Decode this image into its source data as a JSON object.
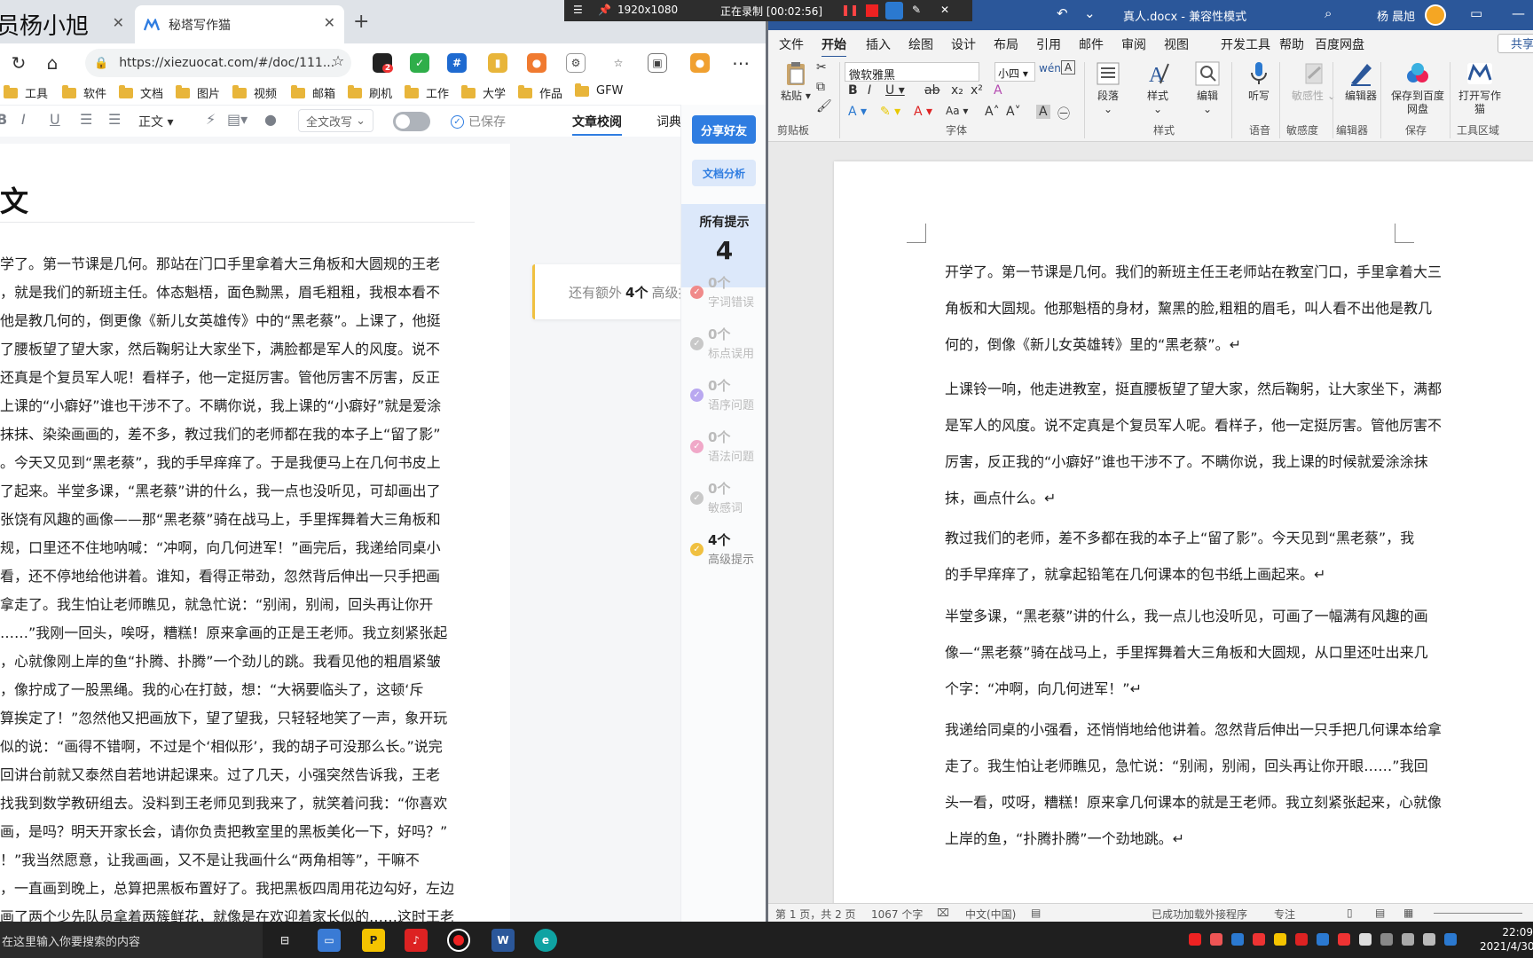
{
  "browser": {
    "tabs": [
      {
        "label": "员杨小旭"
      },
      {
        "label": "秘塔写作猫"
      }
    ],
    "url": "https://xiezuocat.com/#/doc/111...",
    "extension_badge": "2",
    "bookmarks": [
      "工具",
      "软件",
      "文档",
      "图片",
      "视频",
      "邮箱",
      "刷机",
      "工作",
      "大学",
      "作品",
      "GFW"
    ]
  },
  "editor": {
    "style_label": "正文",
    "rewrite_label": "全文改写",
    "saved_label": "已保存",
    "tabs": [
      "文章校阅",
      "词典"
    ],
    "title": "文",
    "lines": [
      "学了。第一节课是几何。那站在门口手里拿着大三角板和大圆规的王老",
      "，就是我们的新班主任。体态魁梧，面色黝黑，眉毛粗粗，我根本看不",
      "他是教几何的，倒更像《新儿女英雄传》中的“黑老蔡”。上课了，他挺",
      "了腰板望了望大家，然后鞠躬让大家坐下，满脸都是军人的风度。说不",
      "还真是个复员军人呢！看样子，他一定挺厉害。管他厉害不厉害，反正",
      "上课的“小癖好”谁也干涉不了。不瞒你说，我上课的“小癖好”就是爱涂",
      "抹抹、染染画画的，差不多，教过我们的老师都在我的本子上“留了影”",
      "。今天又见到“黑老蔡”，我的手早痒痒了。于是我便马上在几何书皮上",
      "了起来。半堂多课，“黑老蔡”讲的什么，我一点也没听见，可却画出了",
      "张饶有风趣的画像——那“黑老蔡”骑在战马上，手里挥舞着大三角板和",
      "规，口里还不住地呐喊：“冲啊，向几何进军！”画完后，我递给同桌小",
      "看，还不停地给他讲着。谁知，看得正带劲，忽然背后伸出一只手把画",
      "拿走了。我生怕让老师瞧见，就急忙说：“别闹，别闹，回头再让你开",
      "……”我刚一回头，唉呀，糟糕！原来拿画的正是王老师。我立刻紧张起",
      "，心就像刚上岸的鱼“扑腾、扑腾”一个劲儿的跳。我看见他的粗眉紧皱",
      "，像拧成了一股黑绳。我的心在打鼓，想：“大祸要临头了，这顿‘斥",
      "算挨定了！”忽然他又把画放下，望了望我，只轻轻地笑了一声，象开玩",
      "似的说：“画得不错啊，不过是个‘相似形’，我的胡子可没那么长。”说完",
      "回讲台前就又泰然自若地讲起课来。过了几天，小强突然告诉我，王老",
      "找我到数学教研组去。没料到王老师见到我来了，就笑着问我：“你喜欢",
      "画，是吗？明天开家长会，请你负责把教室里的黑板美化一下，好吗？”",
      "！”我当然愿意，让我画画，又不是让我画什么“两角相等”，干嘛不",
      "，一直画到晚上，总算把黑板布置好了。我把黑板四周用花边勾好，左边",
      "画了两个少先队员拿着两簇鲜花，就像是在欢迎着家长似的……这时王老"
    ],
    "notice": {
      "prefix": "还有额外",
      "count": "4个",
      "suffix": "高级提示"
    },
    "panel": {
      "share_label": "分享好友",
      "analyze_label": "文档分析",
      "all_hints_label": "所有提示",
      "all_hints_count": "4",
      "categories": [
        {
          "count": "0个",
          "label": "字词错误",
          "color": "#f08a8a"
        },
        {
          "count": "0个",
          "label": "标点误用",
          "color": "#c8c8c8"
        },
        {
          "count": "0个",
          "label": "语序问题",
          "color": "#b9a8f0"
        },
        {
          "count": "0个",
          "label": "语法问题",
          "color": "#f0a8c8"
        },
        {
          "count": "0个",
          "label": "敏感词",
          "color": "#c8c8c8"
        },
        {
          "count": "4个",
          "label": "高级提示",
          "color": "#f0c040"
        }
      ]
    }
  },
  "recorder": {
    "resolution": "1920x1080",
    "status": "正在录制 [00:02:56]"
  },
  "word": {
    "title": "真人.docx - 兼容性模式",
    "user": "杨 晨旭",
    "menu": [
      "文件",
      "开始",
      "插入",
      "绘图",
      "设计",
      "布局",
      "引用",
      "邮件",
      "审阅",
      "视图",
      "开发工具",
      "帮助",
      "百度网盘"
    ],
    "share_label": "共享",
    "font_name": "微软雅黑",
    "font_size": "小四",
    "ribbon_groups": [
      "剪贴板",
      "字体",
      "样式",
      "语音",
      "敏感度",
      "编辑器",
      "保存",
      "工具区域"
    ],
    "ribbon_buttons": [
      "粘贴",
      "段落",
      "样式",
      "编辑",
      "听写",
      "敏感性",
      "编辑器",
      "保存到百度网盘",
      "打开写作猫"
    ],
    "paragraphs": [
      [
        "开学了。第一节课是几何。我们的新班主任王老师站在教室门口，手里拿着大三",
        "角板和大圆规。他那魁梧的身材，黧黑的脸,粗粗的眉毛，叫人看不出他是教几",
        "何的，倒像《新儿女英雄转》里的“黑老蔡”。↵"
      ],
      [
        "上课铃一响，他走进教室，挺直腰板望了望大家，然后鞠躬，让大家坐下，满都",
        "是军人的风度。说不定真是个复员军人呢。看样子，他一定挺厉害。管他厉害不",
        "厉害，反正我的“小癖好”谁也干涉不了。不瞒你说，我上课的时候就爱涂涂抹",
        "抹，画点什么。↵"
      ],
      [
        "教过我们的老师，差不多都在我的本子上“留了影”。今天见到“黑老蔡”，我",
        "的手早痒痒了，就拿起铅笔在几何课本的包书纸上画起来。↵"
      ],
      [
        "半堂多课，“黑老蔡”讲的什么，我一点儿也没听见，可画了一幅满有风趣的画",
        "像—“黑老蔡”骑在战马上，手里挥舞着大三角板和大圆规，从口里还吐出来几",
        "个字：“冲啊，向几何进军！”↵"
      ],
      [
        "我递给同桌的小强看，还悄悄地给他讲着。忽然背后伸出一只手把几何课本给拿",
        "走了。我生怕让老师瞧见，急忙说：“别闹，别闹，回头再让你开眼……”我回",
        "头一看，哎呀，糟糕！原来拿几何课本的就是王老师。我立刻紧张起来，心就像",
        "上岸的鱼，“扑腾扑腾”一个劲地跳。↵"
      ]
    ],
    "status": {
      "page": "第 1 页，共 2 页",
      "words": "1067 个字",
      "lang": "中文(中国)",
      "addin": "已成功加载外接程序",
      "focus": "专注"
    }
  },
  "taskbar": {
    "search_placeholder": "在这里输入你要搜索的内容",
    "time": "22:09",
    "date": "2021/4/30"
  }
}
